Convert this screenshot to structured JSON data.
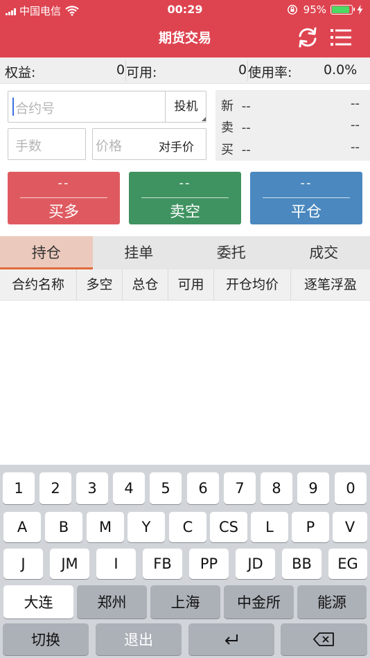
{
  "status": {
    "carrier": "中国电信",
    "time": "00:29",
    "battery": "95%"
  },
  "nav": {
    "title": "期货交易"
  },
  "account": {
    "equity_label": "权益:",
    "equity_value": "0",
    "available_label": "可用:",
    "available_value": "0",
    "usage_label": "使用率:",
    "usage_value": "0.0%"
  },
  "order_form": {
    "contract_placeholder": "合约号",
    "speculate_label": "投机",
    "lots_placeholder": "手数",
    "price_placeholder": "价格",
    "counterparty_price_label": "对手价"
  },
  "quote": {
    "latest_label": "新",
    "latest_value_left": "--",
    "latest_value_right": "--",
    "ask_label": "卖",
    "ask_value_left": "--",
    "ask_value_right": "--",
    "bid_label": "买",
    "bid_value_left": "--",
    "bid_value_right": "--"
  },
  "actions": {
    "buy_price": "--",
    "buy_label": "买多",
    "sell_price": "--",
    "sell_label": "卖空",
    "close_price": "--",
    "close_label": "平仓"
  },
  "tabs": [
    "持仓",
    "挂单",
    "委托",
    "成交"
  ],
  "table_headers": [
    "合约名称",
    "多空",
    "总仓",
    "可用",
    "开仓均价",
    "逐笔浮盈"
  ],
  "keyboard": {
    "row1": [
      "1",
      "2",
      "3",
      "4",
      "5",
      "6",
      "7",
      "8",
      "9",
      "0"
    ],
    "row2": [
      "A",
      "B",
      "M",
      "Y",
      "C",
      "CS",
      "L",
      "P",
      "V"
    ],
    "row3": [
      "J",
      "JM",
      "I",
      "FB",
      "PP",
      "JD",
      "BB",
      "EG"
    ],
    "row4": [
      "大连",
      "郑州",
      "上海",
      "中金所",
      "能源"
    ],
    "row5": [
      "切换",
      "退出"
    ]
  },
  "colors": {
    "brand_red": "#de4450",
    "buy": "#de5a60",
    "sell": "#3f9361",
    "close": "#4a88bf",
    "active_tab_underline": "#e06a3a"
  }
}
